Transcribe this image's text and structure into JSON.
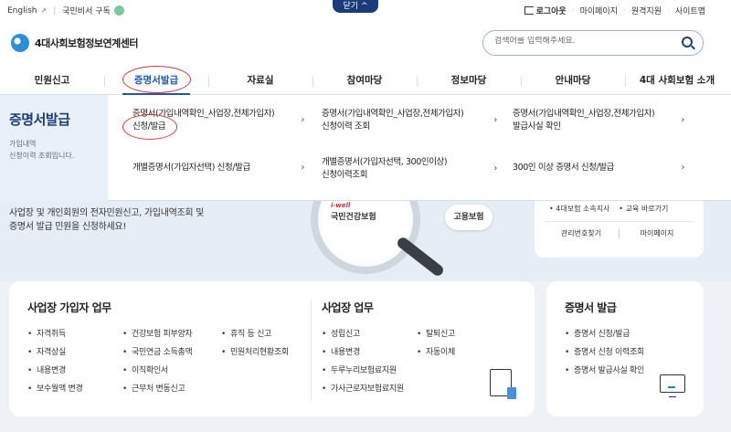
{
  "util": {
    "english": "English",
    "secretary": "국민비서 구독",
    "close_tab": "닫기",
    "logout": "로그아웃",
    "mypage": "마이페이지",
    "remote": "원격지원",
    "sitemap": "사이트맵"
  },
  "header": {
    "logo": "4대사회보험정보연계센터",
    "search_placeholder": "검색어를 입력해주세요."
  },
  "gnb": [
    "민원신고",
    "증명서발급",
    "자료실",
    "참여마당",
    "정보마당",
    "안내마당",
    "4대 사회보험 소개"
  ],
  "mega": {
    "title": "증명서발급",
    "desc_line1": "가입내역",
    "desc_line2": "신청이력 조회입니다.",
    "items": [
      {
        "line1": "증명서(가입내역확인_사업장,전체가입자)",
        "line2": "신청/발급"
      },
      {
        "line1": "증명서(가입내역확인_사업장,전체가입자)",
        "line2": "신청이력 조회"
      },
      {
        "line1": "증명서(가입내역확인_사업장,전체가입자)",
        "line2": "발급사실 확인"
      },
      {
        "line1": "개별증명서(가입자선택) 신청/발급",
        "line2": ""
      },
      {
        "line1": "개별증명서(가입자선택, 300인이상)",
        "line2": "신청이력조회"
      },
      {
        "line1": "300인 이상 증명서 신청/발급",
        "line2": ""
      }
    ]
  },
  "hero": {
    "line1": "사업장 및 개인회원의 전자민원신고, 가입내역조회 및",
    "line2": "증명서 발급 민원을 신청하세요!",
    "brand_iwell": "i-well",
    "brand": "국민건강보험",
    "badge": "고용보험",
    "login_link1": "4대보험 소속지사",
    "login_link2": "교육 바로가기",
    "login_link3": "관리번호찾기",
    "login_link4": "마이페이지"
  },
  "cards": {
    "member_title": "사업장 가입자 업무",
    "member_items": [
      "자격취득",
      "건강보험 피부양자",
      "휴직 등 신고",
      "자격상실",
      "국민연금 소득총액",
      "민원처리현황조회",
      "내용변경",
      "이직확인서",
      "보수월액 변경",
      "근무처 변동신고"
    ],
    "biz_title": "사업장 업무",
    "biz_items": [
      "성립신고",
      "탈퇴신고",
      "내용변경",
      "자동이체",
      "두루누리보험료지원",
      "가사근로자보험료지원"
    ],
    "cert_title": "증명서 발급",
    "cert_items": [
      "증명서 신청/발급",
      "증명서 신청 이력조회",
      "증명서 발급사실 확인"
    ]
  }
}
